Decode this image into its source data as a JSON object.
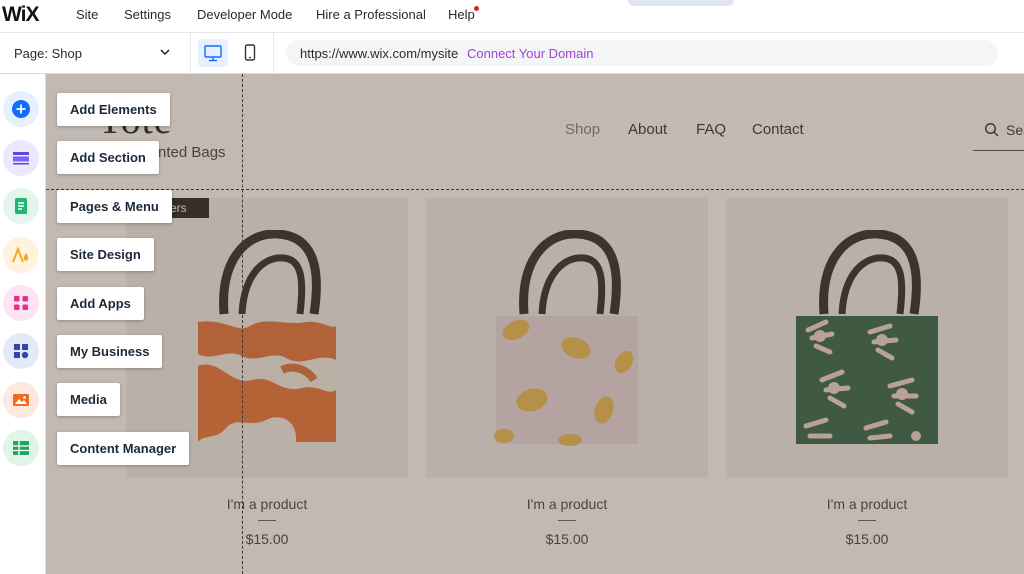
{
  "top_menu": {
    "logo": "WiX",
    "items": [
      "Site",
      "Settings",
      "Developer Mode",
      "Hire a Professional",
      "Help"
    ]
  },
  "sub_bar": {
    "page_selector": "Page: Shop",
    "url": "https://www.wix.com/mysite",
    "connect_domain": "Connect Your Domain"
  },
  "sidebar": {
    "items": [
      {
        "label": "Add Elements",
        "icon": "plus-circle-icon",
        "color": "#116dff"
      },
      {
        "label": "Add Section",
        "icon": "section-icon",
        "color": "#7b61ff"
      },
      {
        "label": "Pages & Menu",
        "icon": "page-icon",
        "color": "#22b573"
      },
      {
        "label": "Site Design",
        "icon": "design-icon",
        "color": "#f5a623"
      },
      {
        "label": "Add Apps",
        "icon": "apps-grid-icon",
        "color": "#e8318b"
      },
      {
        "label": "My Business",
        "icon": "business-icon",
        "color": "#2f4aa6"
      },
      {
        "label": "Media",
        "icon": "image-icon",
        "color": "#f06c1c"
      },
      {
        "label": "Content Manager",
        "icon": "table-icon",
        "color": "#23a55a"
      }
    ]
  },
  "site": {
    "title": "Tote",
    "subtitle": "nted Bags",
    "nav": [
      "Shop",
      "About",
      "FAQ",
      "Contact"
    ],
    "search_label": "Sea",
    "badge": "ellers",
    "products": [
      {
        "name": "I'm a product",
        "price": "$15.00",
        "pattern": "orange-brush-bag"
      },
      {
        "name": "I'm a product",
        "price": "$15.00",
        "pattern": "lemon-bag"
      },
      {
        "name": "I'm a product",
        "price": "$15.00",
        "pattern": "green-hands-bag"
      }
    ]
  }
}
